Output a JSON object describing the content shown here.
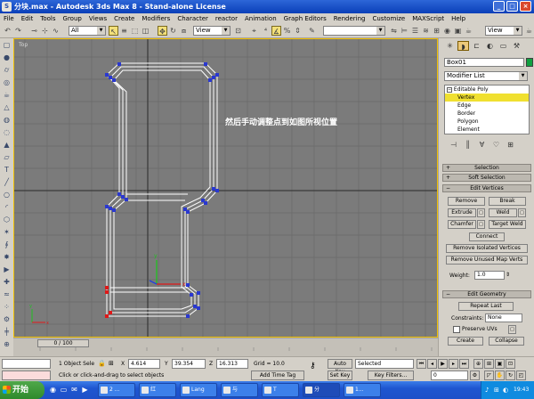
{
  "window": {
    "title": "分块.max - Autodesk 3ds Max 8 - Stand-alone License",
    "icon": "3dsmax-app-icon",
    "buttons": [
      "minimize",
      "maximize",
      "close"
    ]
  },
  "menu": {
    "items": [
      "File",
      "Edit",
      "Tools",
      "Group",
      "Views",
      "Create",
      "Modifiers",
      "Character",
      "reactor",
      "Animation",
      "Graph Editors",
      "Rendering",
      "Customize",
      "MAXScript",
      "Help"
    ]
  },
  "toolbar": {
    "selection_filter": "All",
    "ref_coord": "View",
    "named_selection": "",
    "render_view": "View"
  },
  "viewport": {
    "label": "Top",
    "annotation": "然后手动调整点到如图所视位置",
    "background": "#7b7b7b",
    "active_border": "#f0c000",
    "time_slider": "0 / 100"
  },
  "command_panel": {
    "object_name": "Box01",
    "object_color": "#10a040",
    "modifier_list": "Modifier List",
    "stack": {
      "modifier": "Editable Poly",
      "subobjects": [
        "Vertex",
        "Edge",
        "Border",
        "Polygon",
        "Element"
      ],
      "selected_subobject": "Vertex"
    },
    "rollouts": {
      "selection": "Selection",
      "soft_selection": "Soft Selection",
      "edit_vertices": "Edit Vertices",
      "edit_geometry": "Edit Geometry"
    },
    "edit_vertices": {
      "remove": "Remove",
      "break": "Break",
      "extrude": "Extrude",
      "weld": "Weld",
      "chamfer": "Chamfer",
      "target_weld": "Target Weld",
      "connect": "Connect",
      "remove_isolated": "Remove Isolated Vertices",
      "remove_unused": "Remove Unused Map Verts",
      "weight_label": "Weight:",
      "weight_value": "1.0"
    },
    "edit_geometry": {
      "repeat_last": "Repeat Last",
      "constraints_label": "Constraints:",
      "constraints_value": "None",
      "preserve_uvs": "Preserve UVs",
      "create": "Create",
      "collapse": "Collapse"
    }
  },
  "status": {
    "selection_count": "1 Object Sele",
    "x_value": "4.614",
    "y_value": "39.354",
    "z_value": "16.313",
    "grid": "Grid = 10.0",
    "auto_key": "Auto Key",
    "key_mode": "Selected",
    "set_key": "Set Key",
    "key_filters": "Key Filters...",
    "frame": "0",
    "prompt": "Click or click-and-drag to select objects",
    "add_time_tag": "Add Time Tag"
  },
  "taskbar": {
    "start_label": "开始",
    "tasks": [
      "2 ...",
      "红",
      "Lang",
      "与",
      "T",
      "分",
      "1..."
    ],
    "clock": "19:43"
  }
}
